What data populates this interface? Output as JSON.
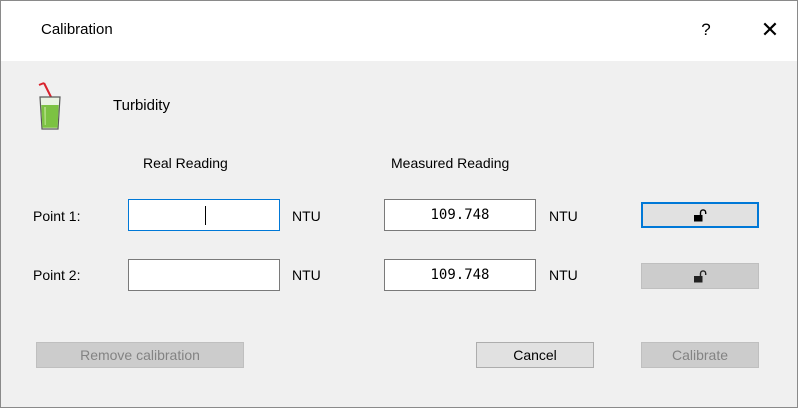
{
  "window": {
    "title": "Calibration",
    "help_label": "?",
    "close_label": "✕"
  },
  "sensor": {
    "name": "Turbidity",
    "icon": "beaker-icon"
  },
  "columns": {
    "real": "Real Reading",
    "measured": "Measured Reading"
  },
  "points": [
    {
      "label": "Point 1:",
      "real_value": "",
      "real_unit": "NTU",
      "measured_value": "109.748",
      "measured_unit": "NTU",
      "lock_icon": "unlocked-padlock-icon"
    },
    {
      "label": "Point 2:",
      "real_value": "",
      "real_unit": "NTU",
      "measured_value": "109.748",
      "measured_unit": "NTU",
      "lock_icon": "unlocked-padlock-icon"
    }
  ],
  "buttons": {
    "remove": "Remove calibration",
    "cancel": "Cancel",
    "calibrate": "Calibrate"
  },
  "colors": {
    "focus": "#0078d7",
    "liquid": "#7cc242",
    "straw": "#d9232d"
  }
}
